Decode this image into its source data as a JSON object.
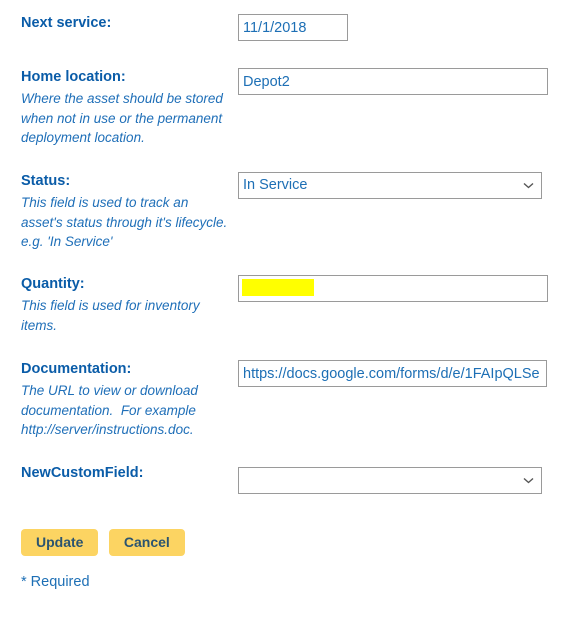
{
  "form": {
    "fields": [
      {
        "name": "next-service",
        "label": "Next service:",
        "help": "",
        "control": "text",
        "value": "11/1/2018",
        "placeholder": ""
      },
      {
        "name": "home-location",
        "label": "Home location:",
        "help": "Where the asset should be stored when not in use or the permanent deployment location.",
        "control": "text",
        "value": "Depot2",
        "placeholder": ""
      },
      {
        "name": "status",
        "label": "Status:",
        "help": "This field is used to track an asset's status through it's lifecycle. e.g. 'In Service'",
        "control": "select",
        "value": "In Service"
      },
      {
        "name": "quantity",
        "label": "Quantity:",
        "help": "This field is used for inventory items.",
        "control": "text",
        "value": "",
        "placeholder": "",
        "redacted": true
      },
      {
        "name": "documentation",
        "label": "Documentation:",
        "help": "The URL to view or download documentation.  For example http://server/instructions.doc.",
        "control": "text",
        "value": "https://docs.google.com/forms/d/e/1FAIpQLSe",
        "placeholder": ""
      },
      {
        "name": "newcustomfield",
        "label": "NewCustomField:",
        "help": "",
        "control": "select",
        "value": ""
      }
    ],
    "buttons": {
      "update_label": "Update",
      "cancel_label": "Cancel"
    },
    "footer": {
      "required_note": "* Required"
    },
    "icons": {
      "dropdown": "chevron-down-icon"
    },
    "colors": {
      "label_blue": "#0a5ca8",
      "help_blue": "#1f6fb8",
      "input_text_blue": "#1d6fb5",
      "input_border": "#9a9a9a",
      "button_bg": "#fcd462",
      "button_text": "#2b5470",
      "redaction_highlight": "#ffff00"
    }
  }
}
